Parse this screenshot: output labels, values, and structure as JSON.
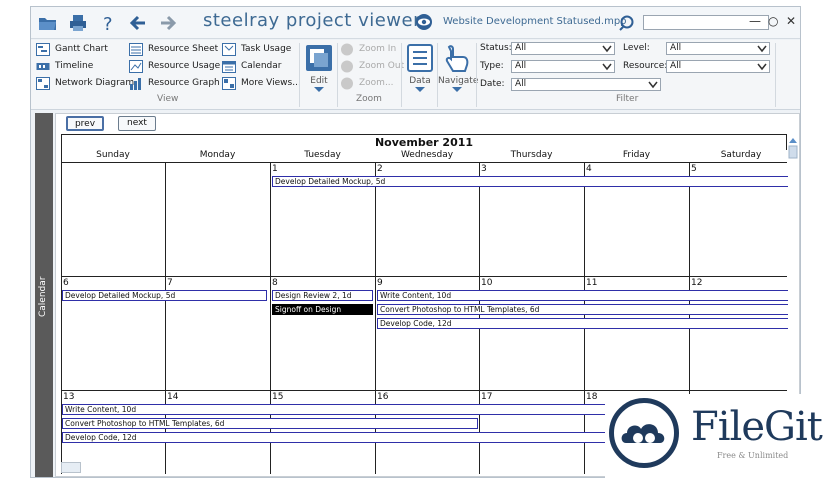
{
  "titlebar": {
    "app_title": "steelray project viewer",
    "file_name": "Website Development Statused.mpp",
    "search_value": ""
  },
  "ribbon": {
    "view": {
      "label": "View",
      "items": [
        "Gantt Chart",
        "Timeline",
        "Network Diagram",
        "Resource Sheet",
        "Resource Usage",
        "Resource Graph",
        "Task Usage",
        "Calendar",
        "More Views..."
      ]
    },
    "edit": {
      "label": "Edit"
    },
    "zoom": {
      "label": "Zoom",
      "items": [
        "Zoom In",
        "Zoom Out",
        "Zoom..."
      ]
    },
    "data": {
      "label": "Data"
    },
    "navigate": {
      "label": "Navigate"
    },
    "filter": {
      "label": "Filter",
      "status_label": "Status:",
      "status_value": "All",
      "type_label": "Type:",
      "type_value": "All",
      "date_label": "Date:",
      "date_value": "All",
      "level_label": "Level:",
      "level_value": "All",
      "resource_label": "Resource:",
      "resource_value": "All"
    }
  },
  "side_tab": "Calendar",
  "calendar": {
    "prev": "prev",
    "next": "next",
    "month": "November 2011",
    "days_of_week": [
      "Sunday",
      "Monday",
      "Tuesday",
      "Wednesday",
      "Thursday",
      "Friday",
      "Saturday"
    ],
    "weeks": [
      [
        "",
        "",
        "1",
        "2",
        "3",
        "4",
        "5"
      ],
      [
        "6",
        "7",
        "8",
        "9",
        "10",
        "11",
        "12"
      ],
      [
        "13",
        "14",
        "15",
        "16",
        "17",
        "18",
        ""
      ]
    ],
    "tasks": {
      "w1": [
        "Develop Detailed Mockup, 5d"
      ],
      "w2": [
        "Develop Detailed Mockup, 5d",
        "Design Review 2, 1d",
        "Signoff on Design",
        "Write Content, 10d",
        "Convert Photoshop to HTML Templates, 6d",
        "Develop Code, 12d"
      ],
      "w3": [
        "Write Content, 10d",
        "Convert Photoshop to HTML Templates, 6d",
        "Develop Code, 12d"
      ]
    }
  },
  "watermark": {
    "name": "FileGit",
    "tagline": "Free & Unlimited"
  }
}
